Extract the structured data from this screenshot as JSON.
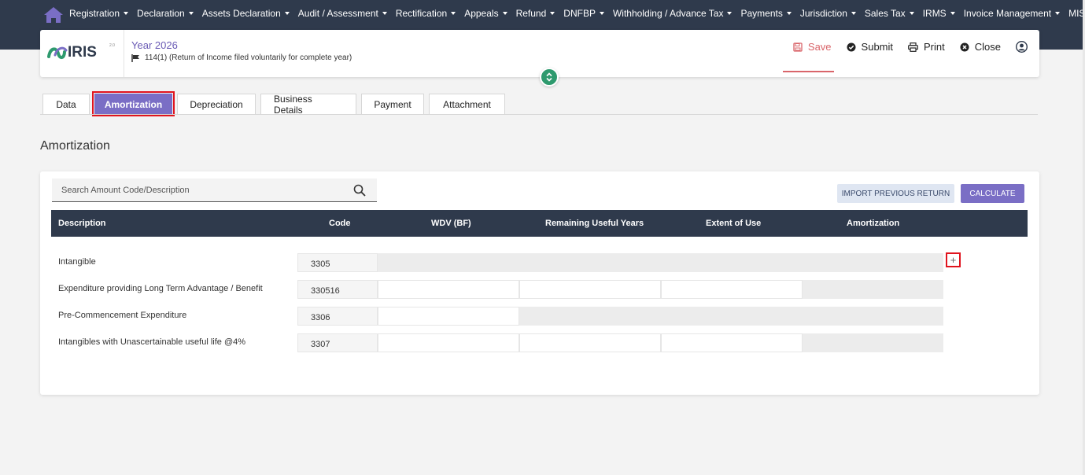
{
  "nav": {
    "items": [
      "Registration",
      "Declaration",
      "Assets Declaration",
      "Audit / Assessment",
      "Rectification",
      "Appeals",
      "Refund",
      "DNFBP",
      "Withholding / Advance Tax",
      "Payments",
      "Jurisdiction",
      "Sales Tax",
      "IRMS",
      "Invoice Management",
      "MIS"
    ]
  },
  "header": {
    "logo_text": "IRIS",
    "logo_superscript": "2.0",
    "year": "Year 2026",
    "return_type": "114(1) (Return of Income filed voluntarily for complete year)",
    "actions": {
      "save": "Save",
      "submit": "Submit",
      "print": "Print",
      "close": "Close"
    }
  },
  "tabs": [
    "Data",
    "Amortization",
    "Depreciation",
    "Business Details",
    "Payment",
    "Attachment"
  ],
  "active_tab": "Amortization",
  "section_title": "Amortization",
  "search": {
    "placeholder": "Search Amount Code/Description"
  },
  "buttons": {
    "import": "IMPORT PREVIOUS RETURN",
    "calculate": "CALCULATE"
  },
  "table": {
    "headers": [
      "Description",
      "Code",
      "WDV (BF)",
      "Remaining Useful Years",
      "Extent of Use",
      "Amortization"
    ],
    "rows": [
      {
        "description": "Intangible",
        "code": "3305"
      },
      {
        "description": "Expenditure providing Long Term Advantage / Benefit",
        "code": "330516"
      },
      {
        "description": "Pre-Commencement Expenditure",
        "code": "3306"
      },
      {
        "description": "Intangibles with Unascertainable useful life @4%",
        "code": "3307"
      }
    ],
    "add_symbol": "+"
  },
  "colors": {
    "nav_bg": "#2f3a4c",
    "accent": "#7a6ec5",
    "save": "#d9656a",
    "highlight": "#e0141e"
  }
}
